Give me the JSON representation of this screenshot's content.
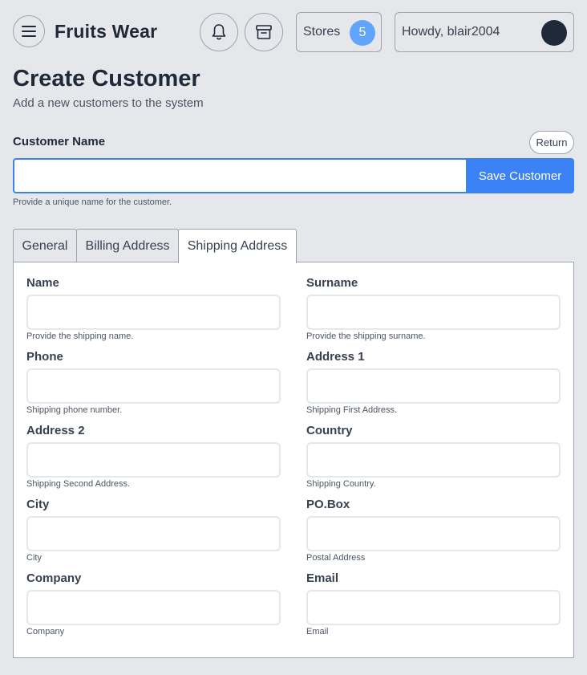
{
  "header": {
    "brand": "Fruits Wear",
    "stores_label": "Stores",
    "stores_count": "5",
    "greeting": "Howdy, blair2004"
  },
  "page": {
    "title": "Create Customer",
    "subtitle": "Add a new customers to the system"
  },
  "customer_name": {
    "label": "Customer Name",
    "return_label": "Return",
    "value": "",
    "save_label": "Save Customer",
    "help": "Provide a unique name for the customer."
  },
  "tabs": [
    {
      "label": "General"
    },
    {
      "label": "Billing Address"
    },
    {
      "label": "Shipping Address"
    }
  ],
  "active_tab": "Shipping Address",
  "fields": [
    {
      "label": "Name",
      "value": "",
      "help": "Provide the shipping name."
    },
    {
      "label": "Surname",
      "value": "",
      "help": "Provide the shipping surname."
    },
    {
      "label": "Phone",
      "value": "",
      "help": "Shipping phone number."
    },
    {
      "label": "Address 1",
      "value": "",
      "help": "Shipping First Address."
    },
    {
      "label": "Address 2",
      "value": "",
      "help": "Shipping Second Address."
    },
    {
      "label": "Country",
      "value": "",
      "help": "Shipping Country."
    },
    {
      "label": "City",
      "value": "",
      "help": "City"
    },
    {
      "label": "PO.Box",
      "value": "",
      "help": "Postal Address"
    },
    {
      "label": "Company",
      "value": "",
      "help": "Company"
    },
    {
      "label": "Email",
      "value": "",
      "help": "Email"
    }
  ],
  "icons": {
    "menu": "hamburger-menu-icon",
    "notifications": "bell-icon",
    "store": "store-icon"
  },
  "colors": {
    "accent": "#3b82f6",
    "badge": "#60a5fa",
    "background": "#e5e7eb",
    "text": "#1f2937"
  }
}
